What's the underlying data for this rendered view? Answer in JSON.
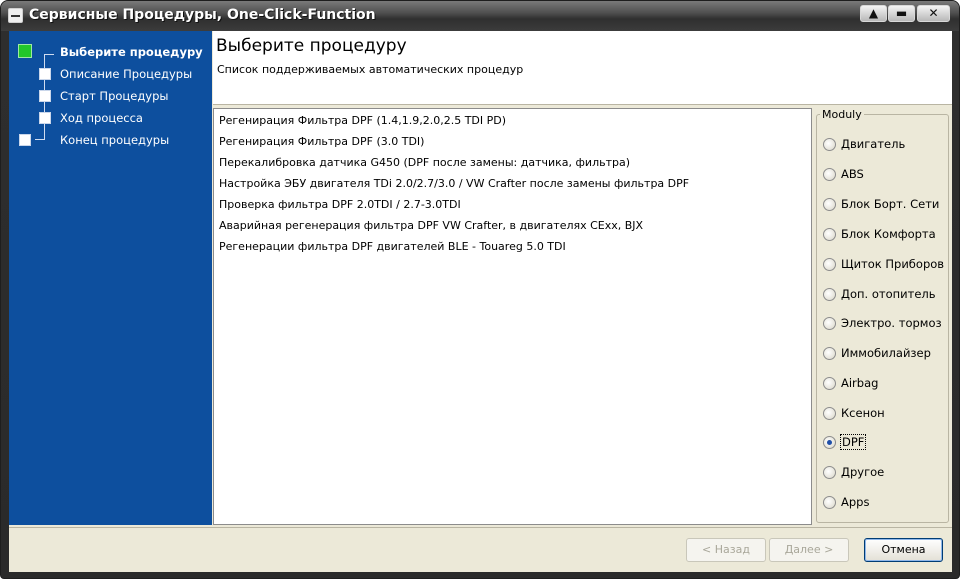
{
  "window": {
    "title": "Сервисные Процедуры, One-Click-Function",
    "controls": {
      "minimize": "▲",
      "maximize": "▬",
      "close": "✕"
    },
    "system_icon": "window-menu-icon"
  },
  "wizard_steps": [
    {
      "label": "Выберите процедуру",
      "state": "current"
    },
    {
      "label": "Описание Процедуры",
      "state": "pending"
    },
    {
      "label": "Старт Процедуры",
      "state": "pending"
    },
    {
      "label": "Ход процесса",
      "state": "pending"
    },
    {
      "label": "Конец процедуры",
      "state": "pending"
    }
  ],
  "header": {
    "title": "Выберите процедуру",
    "subtitle": "Список поддерживаемых автоматических процедур"
  },
  "procedures": [
    "Регенирация Фильтра  DPF (1.4,1.9,2.0,2.5 TDI PD)",
    "Регенирация Фильтра  DPF (3.0 TDI)",
    "Перекалибровка датчика G450 (DPF после  замены: датчика, фильтра)",
    "Настройка ЭБУ двигателя TDi 2.0/2.7/3.0 / VW Crafter после замены фильтра DPF",
    "Проверка фильтра DPF 2.0TDI / 2.7-3.0TDI",
    " Аварийная регенерация фильтра DPF VW Crafter, в двигателях CExx, BJX",
    "Регенерации фильтра DPF двигателей BLE - Touareg 5.0 TDI"
  ],
  "moduly": {
    "legend": "Moduly",
    "options": [
      {
        "label": "Двигатель",
        "checked": false
      },
      {
        "label": "ABS",
        "checked": false
      },
      {
        "label": "Блок Борт. Сети",
        "checked": false
      },
      {
        "label": "Блок Комфорта",
        "checked": false
      },
      {
        "label": "Щиток Приборов",
        "checked": false
      },
      {
        "label": "Доп. отопитель",
        "checked": false
      },
      {
        "label": "Электро. тормоз",
        "checked": false
      },
      {
        "label": "Иммобилайзер",
        "checked": false
      },
      {
        "label": "Airbag",
        "checked": false
      },
      {
        "label": "Ксенон",
        "checked": false
      },
      {
        "label": "DPF",
        "checked": true
      },
      {
        "label": "Другое",
        "checked": false
      },
      {
        "label": "Apps",
        "checked": false
      }
    ]
  },
  "buttons": {
    "back": "< Назад",
    "next": "Далее >",
    "cancel": "Отмена"
  },
  "colors": {
    "sidebar": "#0d4f9e",
    "current_step": "#22c62a"
  }
}
